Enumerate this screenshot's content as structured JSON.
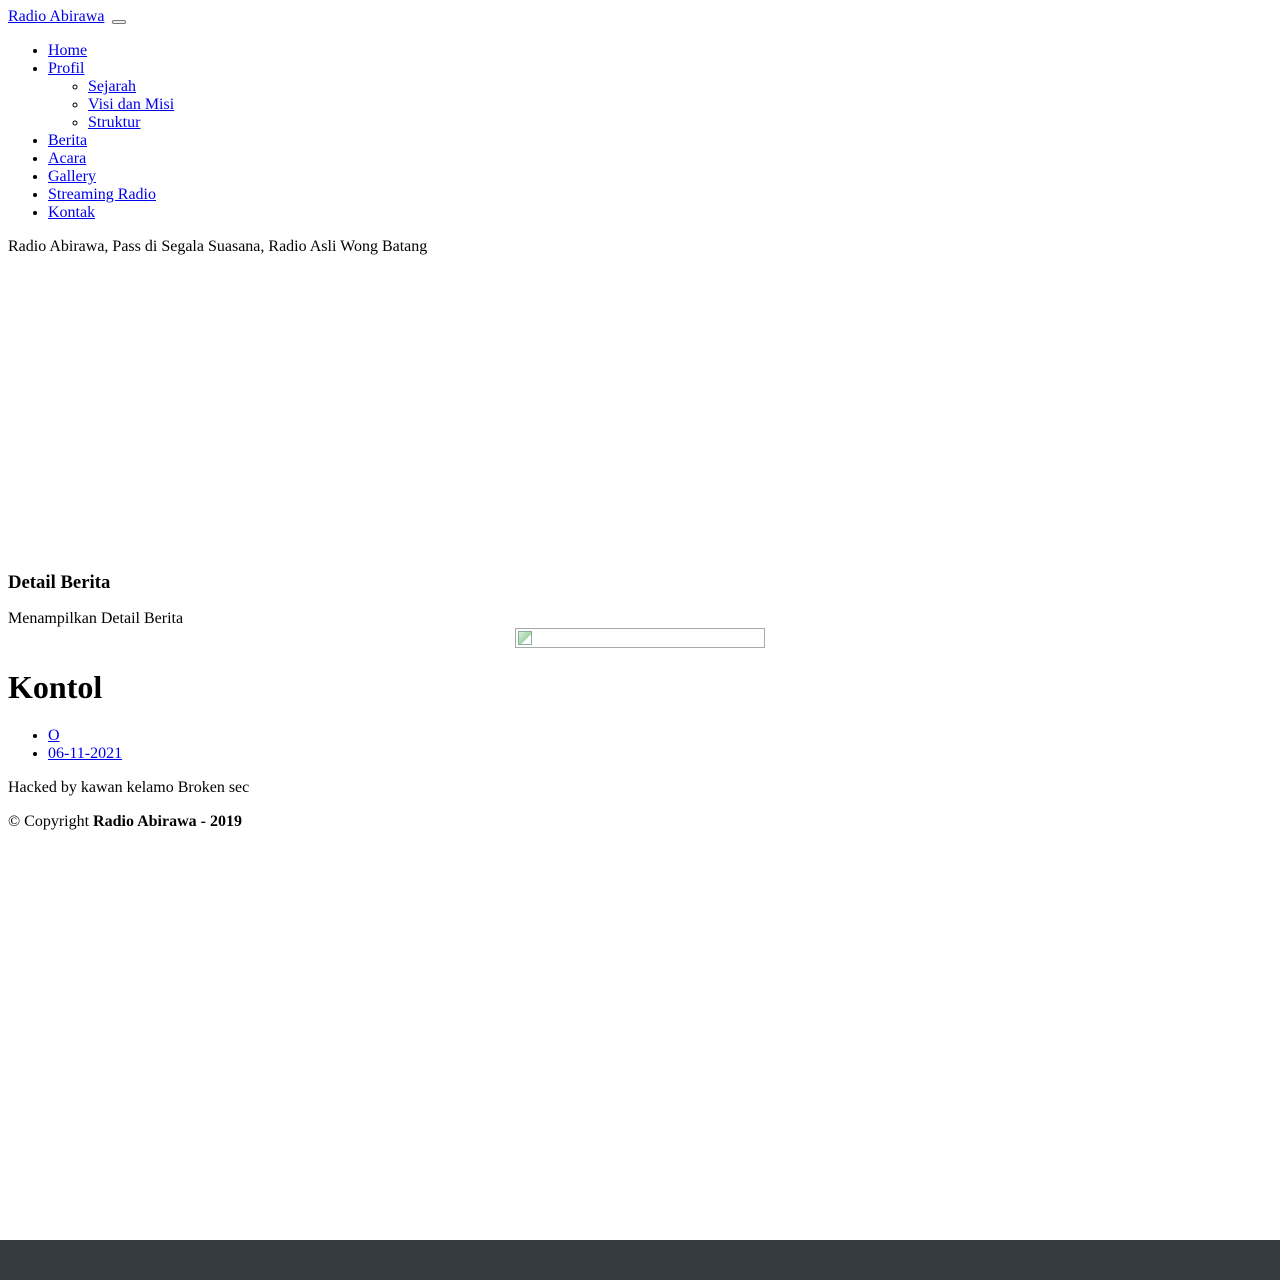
{
  "navbar": {
    "brand": "Radio Abirawa",
    "menu": {
      "home": "Home",
      "profil": "Profil",
      "profil_sub": [
        "Sejarah",
        "Visi dan Misi",
        "Struktur"
      ],
      "berita": "Berita",
      "acara": "Acara",
      "gallery": "Gallery",
      "streaming": "Streaming Radio",
      "kontak": "Kontak"
    }
  },
  "tagline": "Radio Abirawa, Pass di Segala Suasana, Radio Asli Wong Batang",
  "section": {
    "title": "Detail Berita",
    "subtitle": "Menampilkan Detail Berita"
  },
  "article": {
    "title": "Kontol",
    "author": "O",
    "date": "06-11-2021",
    "body": "Hacked by kawan kelamo Broken sec"
  },
  "footer": {
    "copyright_prefix": "© Copyright",
    "copyright_bold": "Radio Abirawa - 2019",
    "bar_color": "#343a40"
  }
}
